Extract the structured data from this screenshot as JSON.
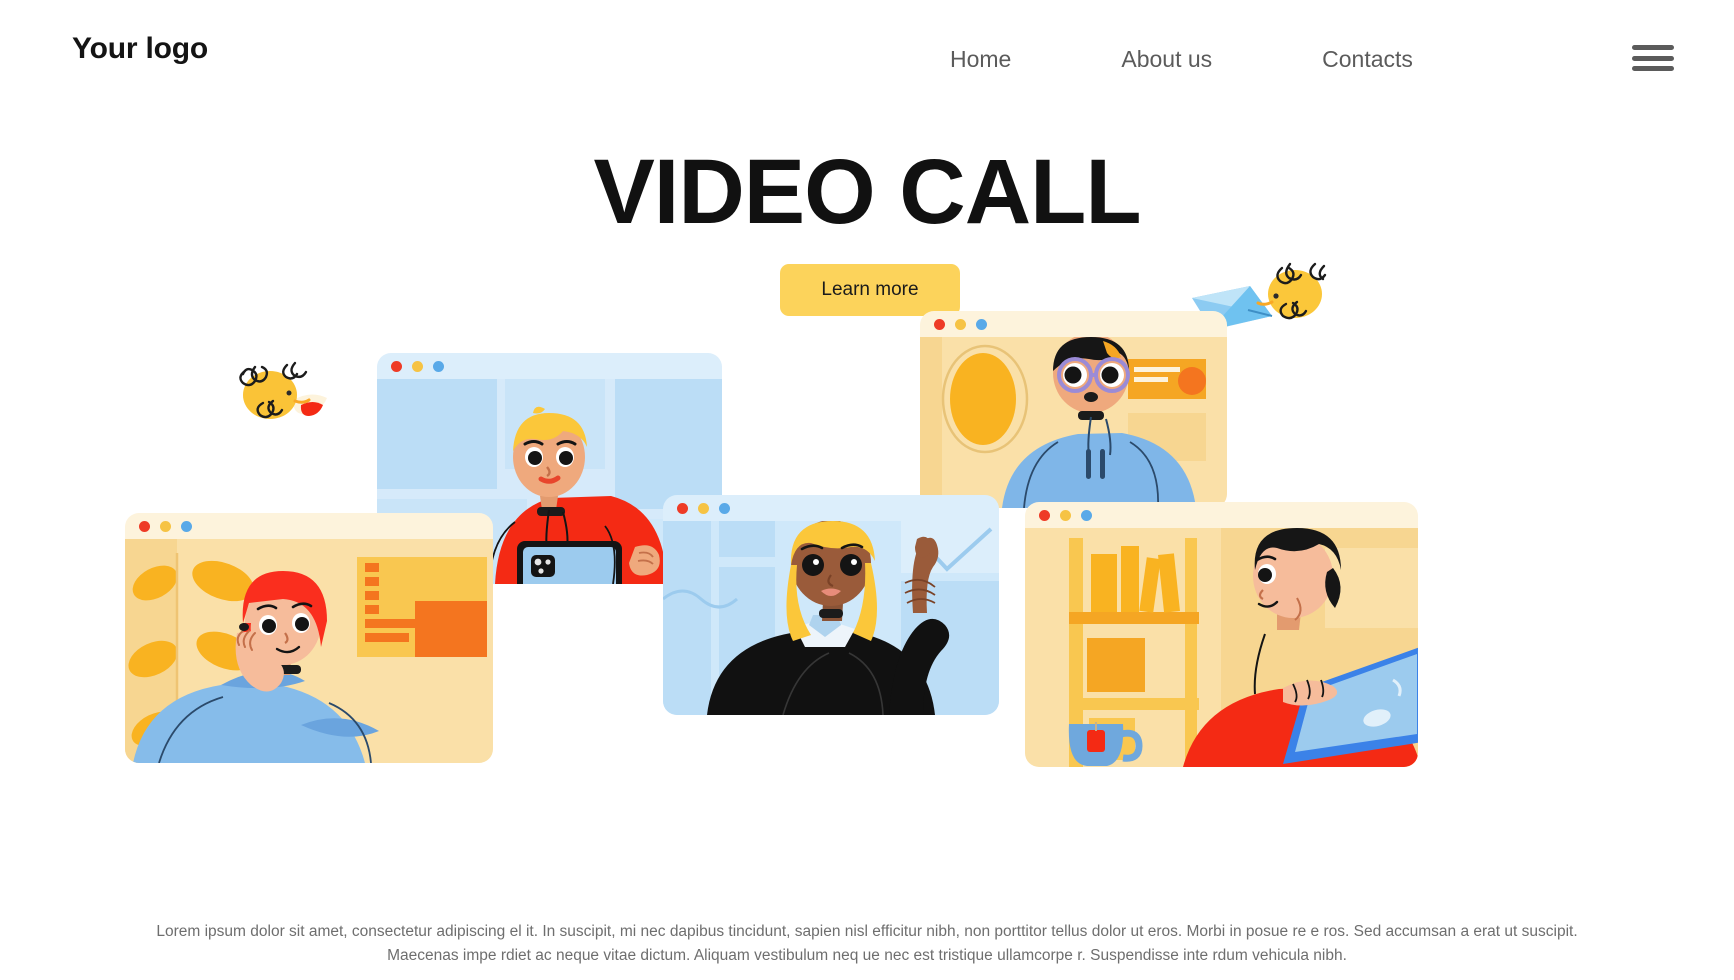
{
  "header": {
    "logo": "Your logo",
    "nav": [
      {
        "label": "Home"
      },
      {
        "label": "About us"
      },
      {
        "label": "Contacts"
      }
    ],
    "menu_icon": "hamburger-menu-icon"
  },
  "hero": {
    "title": "VIDEO CALL",
    "cta_label": "Learn more"
  },
  "footer": {
    "text": "Lorem ipsum dolor sit amet, consectetur adipiscing el  it. In suscipit, mi nec dapibus tincidunt, sapien   nisl efficitur nibh, non porttitor tellus dolor ut eros. Morbi in posue  re e ros. Sed accumsan a erat ut suscipit. Maecenas impe  rdiet ac neque vitae dictum. Aliquam vestibulum neq  ue nec est tristique ullamcorpe r. Suspendisse inte  rdum vehicula nibh."
  },
  "illustration": {
    "window_dots": [
      "red",
      "yellow",
      "blue"
    ],
    "panels": [
      {
        "id": "woman-left",
        "person": "woman with red bob hair resting chin on hand",
        "outfit_color": "#86BCEA",
        "hair_color": "#FA2E1E",
        "background": "yellow leaf pattern"
      },
      {
        "id": "boy-tablet",
        "person": "blond boy holding tablet",
        "outfit_color": "#F42A14",
        "hair_color": "#FBC73A",
        "background": "light blue office"
      },
      {
        "id": "glasses-boy",
        "person": "boy with round purple glasses",
        "outfit_color": "#7FB6E8",
        "hair_color": "#161616",
        "background": "cream room with oval mirror"
      },
      {
        "id": "blonde-woman",
        "person": "blonde woman pointing up",
        "outfit_color": "#111111",
        "hair_color": "#FBC73A",
        "background": "light blue window grid"
      },
      {
        "id": "man-right",
        "person": "man with laptop looking up",
        "outfit_color": "#F42A14",
        "hair_color": "#161616",
        "background": "yellow bookshelf"
      }
    ],
    "decorations": [
      {
        "id": "bee-left",
        "name": "bee-with-letter",
        "color": "#FBC73A"
      },
      {
        "id": "bee-right",
        "name": "bee-with-envelope",
        "color": "#FBC73A",
        "envelope_color": "#6FC2F0"
      }
    ]
  },
  "colors": {
    "accent_yellow": "#FCD35B",
    "red": "#F42A14",
    "blue": "#7FB6E8",
    "text_dark": "#111111",
    "text_muted": "#6e6e6e"
  }
}
